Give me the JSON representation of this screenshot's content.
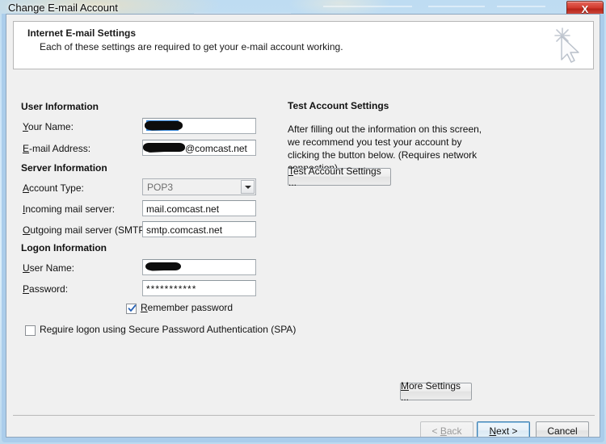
{
  "window": {
    "title": "Change E-mail Account",
    "close_label": "X",
    "close_icon": "close-icon"
  },
  "header": {
    "title": "Internet E-mail Settings",
    "subtitle": "Each of these settings are required to get your e-mail account working.",
    "icon": "cursor-sparkle-icon"
  },
  "user_information": {
    "heading": "User Information",
    "fields": [
      {
        "label_prefix": "",
        "label_accesskey": "Y",
        "label_suffix": "our Name:",
        "value": "",
        "redacted": true
      },
      {
        "label_prefix": "",
        "label_accesskey": "E",
        "label_suffix": "-mail Address:",
        "value": "@comcast.net",
        "redacted": true
      }
    ]
  },
  "server_information": {
    "heading": "Server Information",
    "account_type": {
      "label_prefix": "",
      "label_accesskey": "A",
      "label_suffix": "ccount Type:",
      "value": "POP3",
      "options": [
        "POP3"
      ],
      "disabled": true
    },
    "incoming": {
      "label_prefix": "",
      "label_accesskey": "I",
      "label_suffix": "ncoming mail server:",
      "value": "mail.comcast.net"
    },
    "outgoing": {
      "label_prefix": "",
      "label_accesskey": "O",
      "label_suffix": "utgoing mail server (SMTP):",
      "value": "smtp.comcast.net"
    }
  },
  "logon_information": {
    "heading": "Logon Information",
    "user_name": {
      "label_prefix": "",
      "label_accesskey": "U",
      "label_suffix": "ser Name:",
      "value": "",
      "redacted": true
    },
    "password": {
      "label_prefix": "",
      "label_accesskey": "P",
      "label_suffix": "assword:",
      "value": "***********"
    },
    "remember_password": {
      "label_prefix": "",
      "label_accesskey": "R",
      "label_suffix": "emember password",
      "checked": true
    },
    "require_spa": {
      "label_prefix": "Re",
      "label_accesskey": "q",
      "label_suffix": "uire logon using Secure Password Authentication (SPA)",
      "checked": false
    }
  },
  "test_account": {
    "title": "Test Account Settings",
    "description": "After filling out the information on this screen, we recommend you test your account by clicking the button below. (Requires network connection)",
    "button": {
      "label_prefix": "",
      "label_accesskey": "T",
      "label_suffix": "est Account Settings ..."
    }
  },
  "more_settings": {
    "label_prefix": "",
    "label_accesskey": "M",
    "label_suffix": "ore Settings ..."
  },
  "footer": {
    "back": {
      "label_prefix": "< ",
      "label_accesskey": "B",
      "label_suffix": "ack",
      "disabled": true
    },
    "next": {
      "label_prefix": "",
      "label_accesskey": "N",
      "label_suffix": "ext >",
      "default": true
    },
    "cancel": {
      "label": "Cancel"
    }
  },
  "colors": {
    "dialog_bg": "#f0f0f0",
    "header_bg": "#ffffff",
    "close_red": "#c0392b",
    "default_button_border": "#3c7fb1",
    "selection_blue": "#3b8de0",
    "redaction": "#0d0d0d"
  }
}
